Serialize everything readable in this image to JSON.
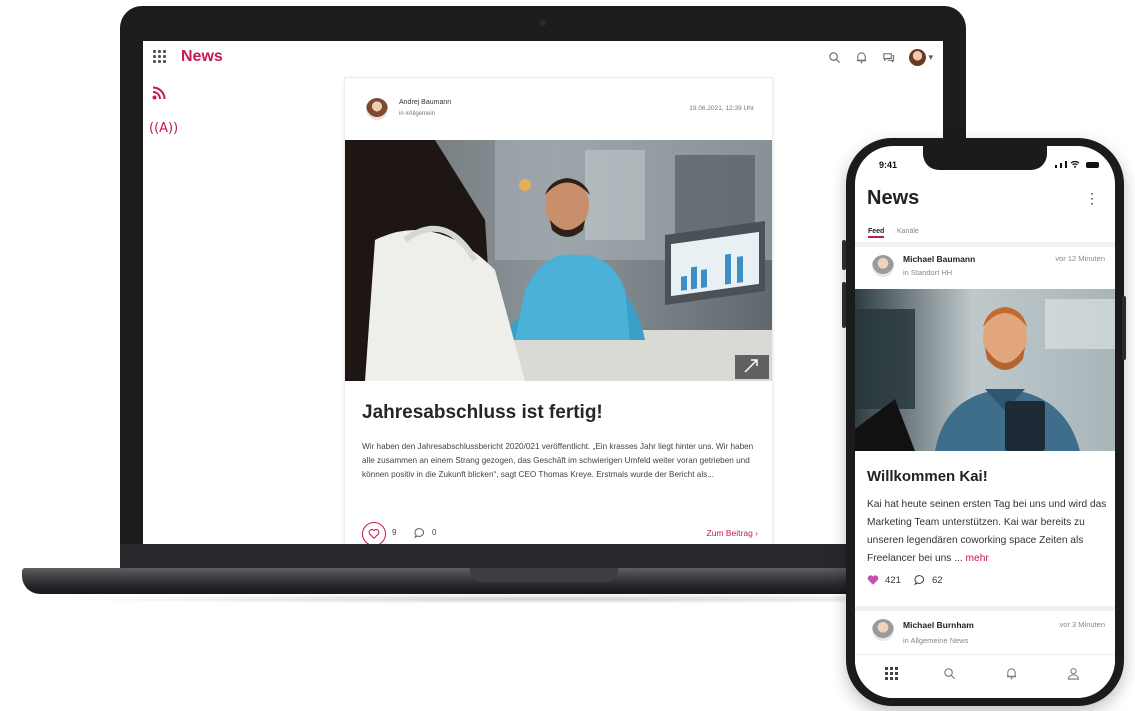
{
  "laptop": {
    "app_title": "News",
    "post": {
      "author": "Andrej Baumann",
      "channel": "in #Allgemein",
      "date": "19.06.2021, 12:39 Uhr",
      "title": "Jahresabschluss ist fertig!",
      "text": "Wir haben den Jahresabschlussbericht 2020/021 veröffentlicht. „Ein krasses Jahr liegt hinter uns. Wir haben alle zusammen an einem Strang gezogen, das Geschäft im schwierigen Umfeld weiter voran getrieben und können positiv in die Zukunft blicken“, sagt CEO Thomas Kreye. Erstmals wurde der Bericht als...",
      "likes": "9",
      "comments": "0",
      "read_more": "Zum Beitrag ›"
    },
    "icons": [
      "apps-grid-icon",
      "rss-icon",
      "broadcast-icon",
      "search-icon",
      "bell-icon",
      "chat-icon",
      "user-avatar"
    ]
  },
  "phone": {
    "time": "9:41",
    "app_title": "News",
    "tabs": [
      "Feed",
      "Kanäle"
    ],
    "active_tab": "Feed",
    "posts": [
      {
        "author": "Michael Baumann",
        "channel": "in Standort HH",
        "time": "vor 12 Minuten",
        "title": "Willkommen Kai!",
        "text": "Kai hat heute seinen ersten Tag bei uns und wird das Marketing Team unterstützen. Kai war bereits zu unseren legendären coworking space Zeiten als Freelancer bei uns ...",
        "more": "mehr",
        "likes": "421",
        "comments": "62"
      },
      {
        "author": "Michael Burnham",
        "channel": "in Allgemeine News",
        "time": "vor 3 Minuten"
      }
    ],
    "nav_icons": [
      "apps-grid-icon",
      "search-icon",
      "bell-icon",
      "user-icon"
    ]
  },
  "colors": {
    "accent": "#c8165a",
    "text": "#262626"
  }
}
